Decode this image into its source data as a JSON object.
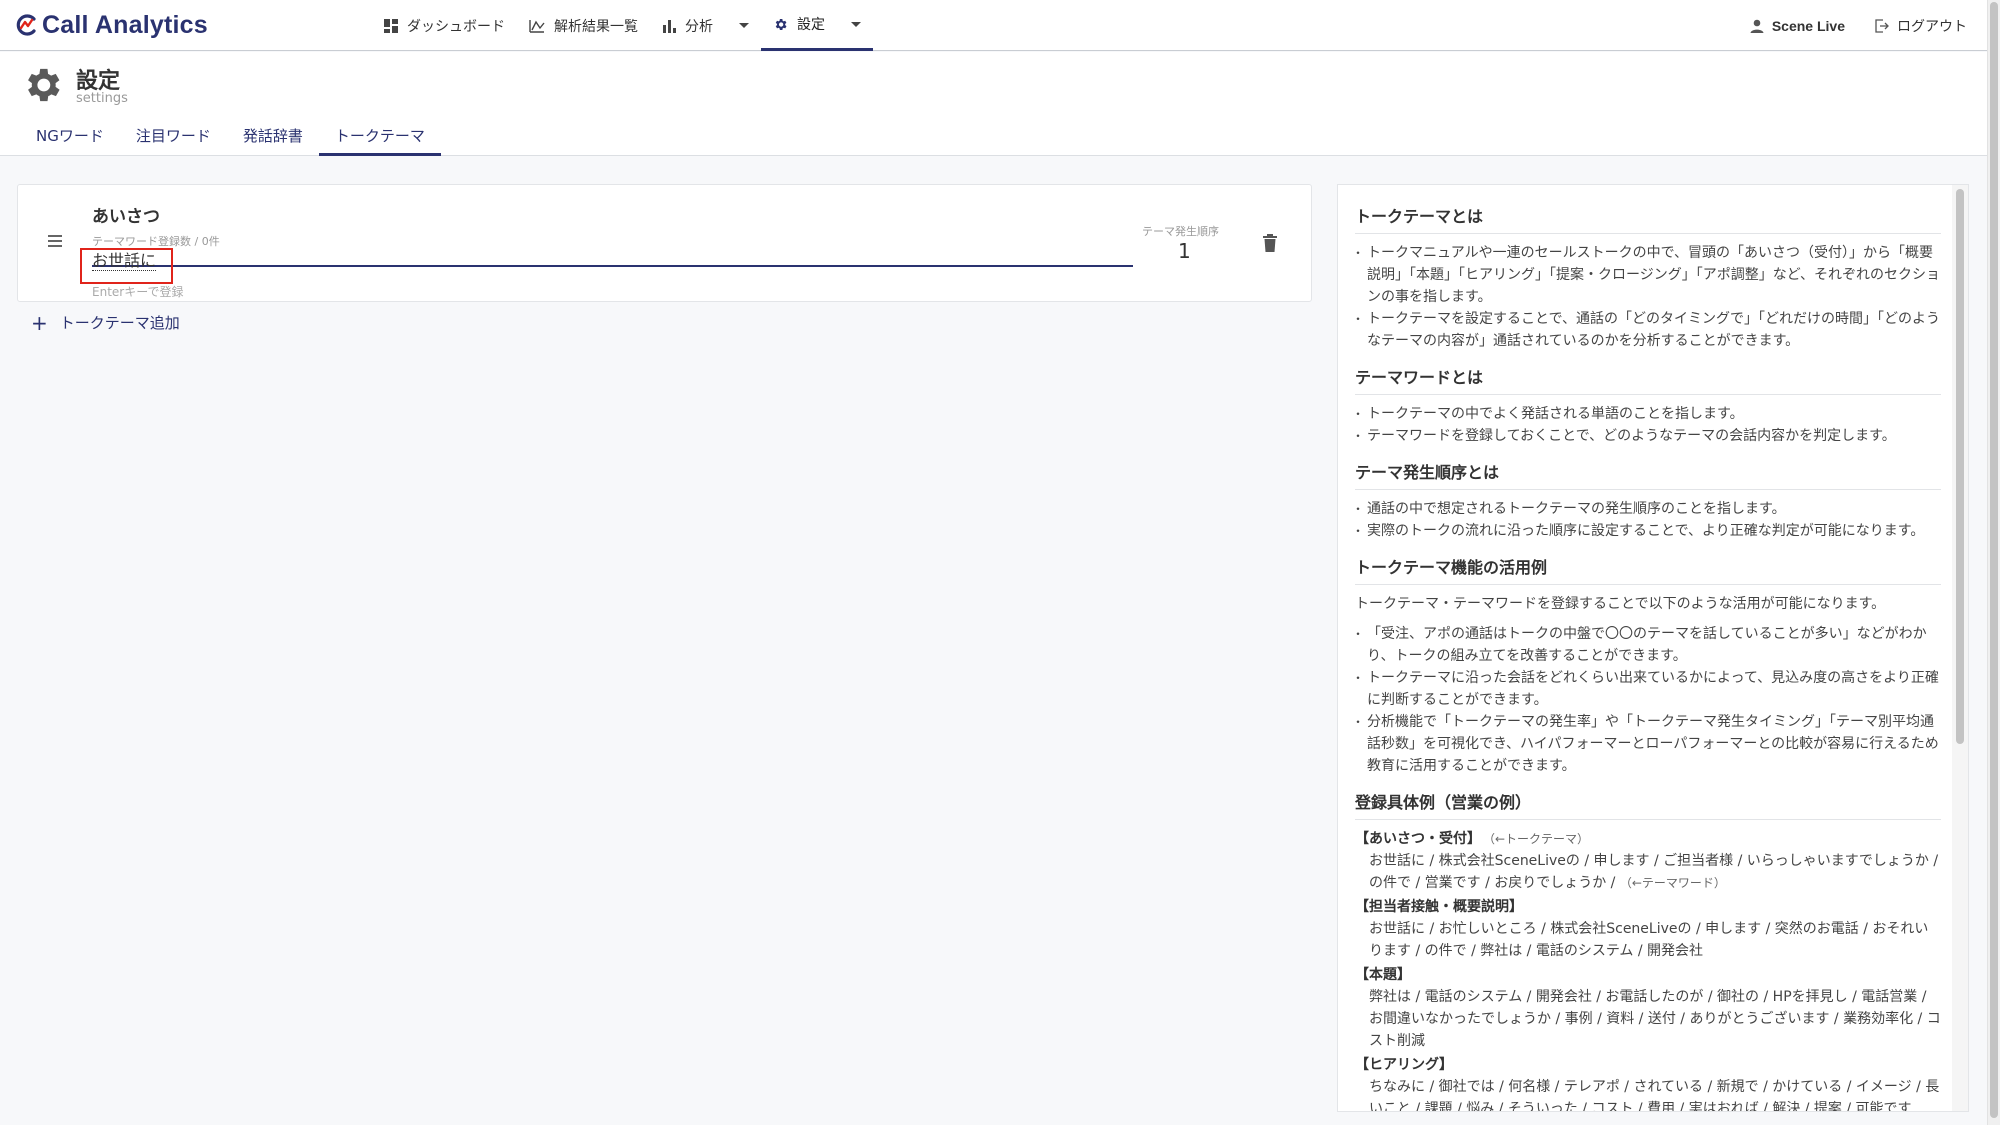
{
  "app": {
    "logo_text": "Call Analytics"
  },
  "nav": {
    "dashboard": "ダッシュボード",
    "results": "解析結果一覧",
    "analysis": "分析",
    "settings": "設定"
  },
  "user": {
    "name": "Scene Live",
    "logout": "ログアウト"
  },
  "page": {
    "title": "設定",
    "subtitle": "settings"
  },
  "tabs": [
    "NGワード",
    "注目ワード",
    "発話辞書",
    "トークテーマ"
  ],
  "theme_card": {
    "name": "あいさつ",
    "word_count_label": "テーマワード登録数 / 0件",
    "input_value": "お世話に",
    "input_hint": "Enterキーで登録",
    "order_label": "テーマ発生順序",
    "order_value": "1"
  },
  "add_theme_label": "トークテーマ追加",
  "help": {
    "s1": {
      "title": "トークテーマとは",
      "items": [
        "トークマニュアルや一連のセールストークの中で、冒頭の「あいさつ（受付）」から「概要説明」「本題」「ヒアリング」「提案・クロージング」「アポ調整」など、それぞれのセクションの事を指します。",
        "トークテーマを設定することで、通話の「どのタイミングで」「どれだけの時間」「どのようなテーマの内容が」通話されているのかを分析することができます。"
      ]
    },
    "s2": {
      "title": "テーマワードとは",
      "items": [
        "トークテーマの中でよく発話される単語のことを指します。",
        "テーマワードを登録しておくことで、どのようなテーマの会話内容かを判定します。"
      ]
    },
    "s3": {
      "title": "テーマ発生順序とは",
      "items": [
        "通話の中で想定されるトークテーマの発生順序のことを指します。",
        "実際のトークの流れに沿った順序に設定することで、より正確な判定が可能になります。"
      ]
    },
    "s4": {
      "title": "トークテーマ機能の活用例",
      "intro": "トークテーマ・テーマワードを登録することで以下のような活用が可能になります。",
      "items": [
        "「受注、アポの通話はトークの中盤で〇〇のテーマを話していることが多い」などがわかり、トークの組み立てを改善することができます。",
        "トークテーマに沿った会話をどれくらい出来ているかによって、見込み度の高さをより正確に判断することができます。",
        "分析機能で「トークテーマの発生率」や「トークテーマ発生タイミング」「テーマ別平均通話秒数」を可視化でき、ハイパフォーマーとローパフォーマーとの比較が容易に行えるため教育に活用することができます。"
      ]
    },
    "s5": {
      "title": "登録具体例（営業の例）",
      "ex1_h": "【あいさつ・受付】",
      "ex1_note": "（←トークテーマ）",
      "ex1_b": "お世話に / 株式会社SceneLiveの / 申します / ご担当者様 / いらっしゃいますでしょうか / の件で / 営業です / お戻りでしょうか /",
      "ex1_bnote": "（←テーマワード）",
      "ex2_h": "【担当者接触・概要説明】",
      "ex2_b": "お世話に / お忙しいところ / 株式会社SceneLiveの / 申します / 突然のお電話 / おそれいります / の件で / 弊社は / 電話のシステム / 開発会社",
      "ex3_h": "【本題】",
      "ex3_b": "弊社は / 電話のシステム / 開発会社 / お電話したのが / 御社の / HPを拝見し / 電話営業 / お間違いなかったでしょうか / 事例 / 資料 / 送付 / ありがとうございます / 業務効率化 / コスト削減",
      "ex4_h": "【ヒアリング】",
      "ex4_b": "ちなみに / 御社では / 何名様 / テレアポ / されている / 新規で / かけている / イメージ / 長いこと / 課題 / 悩み / そういった / コスト / 費用 / 実はおれば / 解決 / 提案 / 可能です"
    }
  },
  "colors": {
    "brand": "#2a3270",
    "highlight": "#e0241b"
  }
}
